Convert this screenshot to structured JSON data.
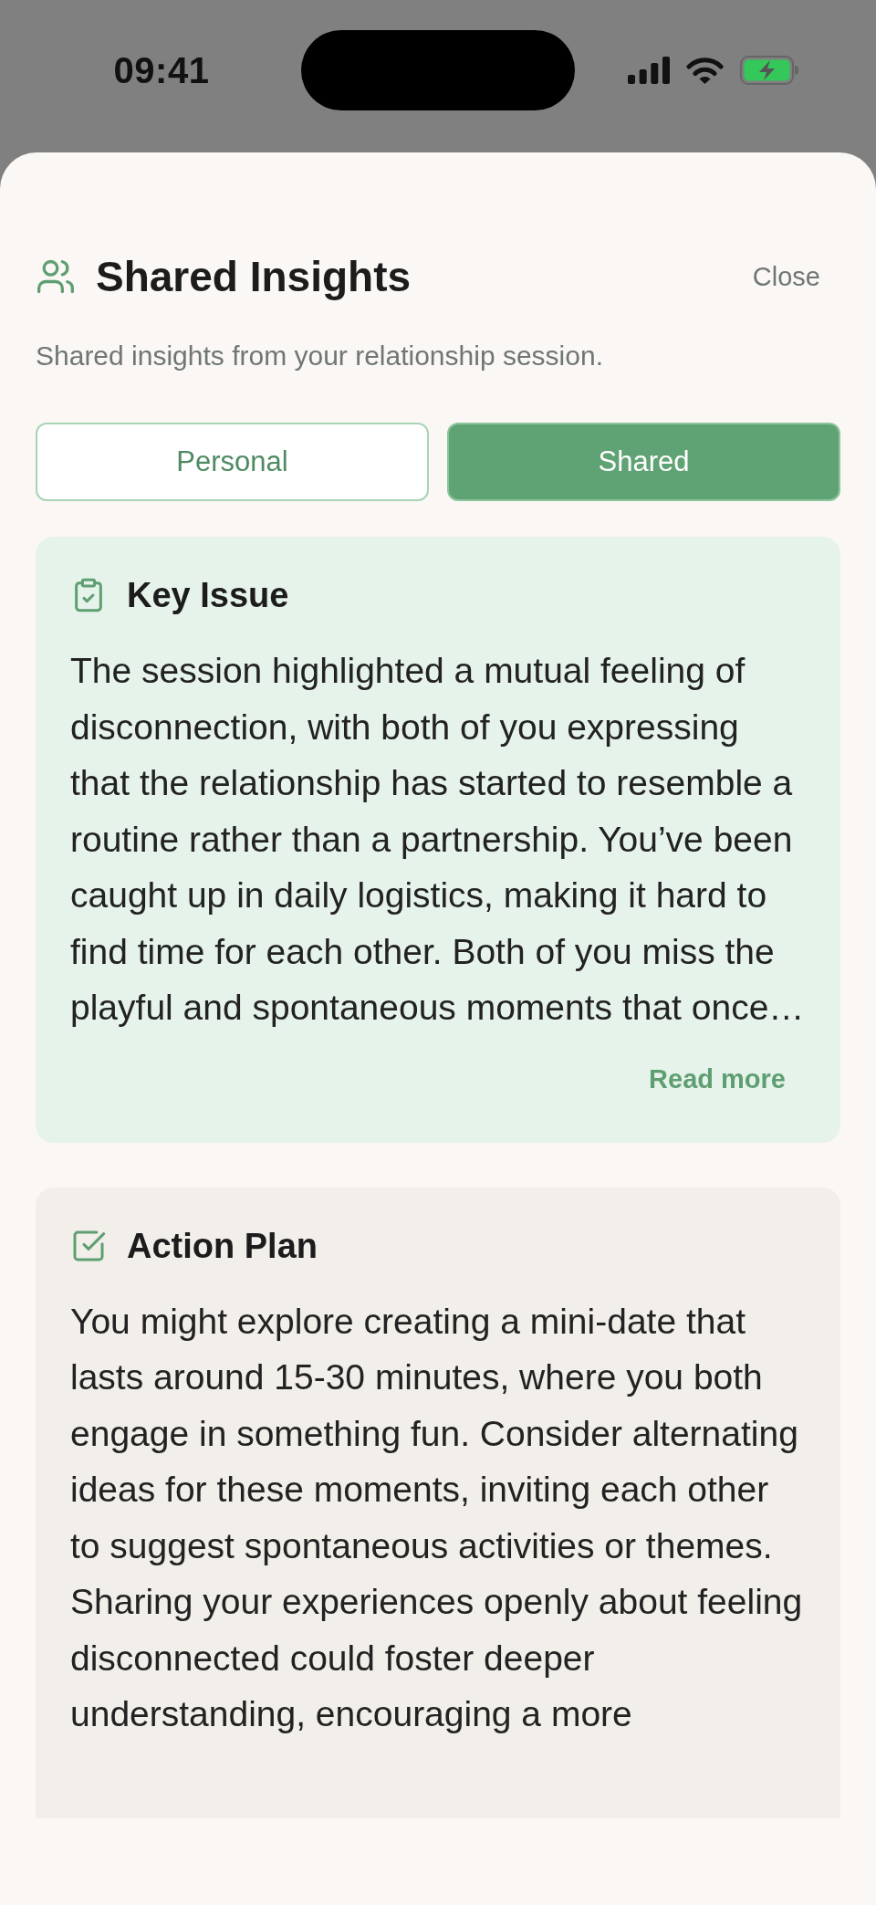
{
  "status_bar": {
    "time": "09:41"
  },
  "sheet": {
    "title": "Shared Insights",
    "close": "Close",
    "subtitle": "Shared insights from your relationship session."
  },
  "tabs": [
    {
      "label": "Personal",
      "selected": false
    },
    {
      "label": "Shared",
      "selected": true
    }
  ],
  "cards": [
    {
      "kind": "key_issue",
      "title": "Key Issue",
      "body": "The session highlighted a mutual feeling of disconnection, with both of you expressing that the relationship has started to resemble a routine rather than a partnership. You’ve been caught up in daily logistics, making it hard to find time for each other. Both of you miss the playful and spontaneous moments that once…",
      "link": "Read more"
    },
    {
      "kind": "action_plan",
      "title": "Action Plan",
      "body": "You might explore creating a mini-date that lasts around 15-30 minutes, where you both engage in something fun. Consider alternating ideas for these moments, inviting each other to suggest spontaneous activities or themes. Sharing your experiences openly about feeling disconnected could foster deeper understanding, encouraging a more"
    }
  ]
}
